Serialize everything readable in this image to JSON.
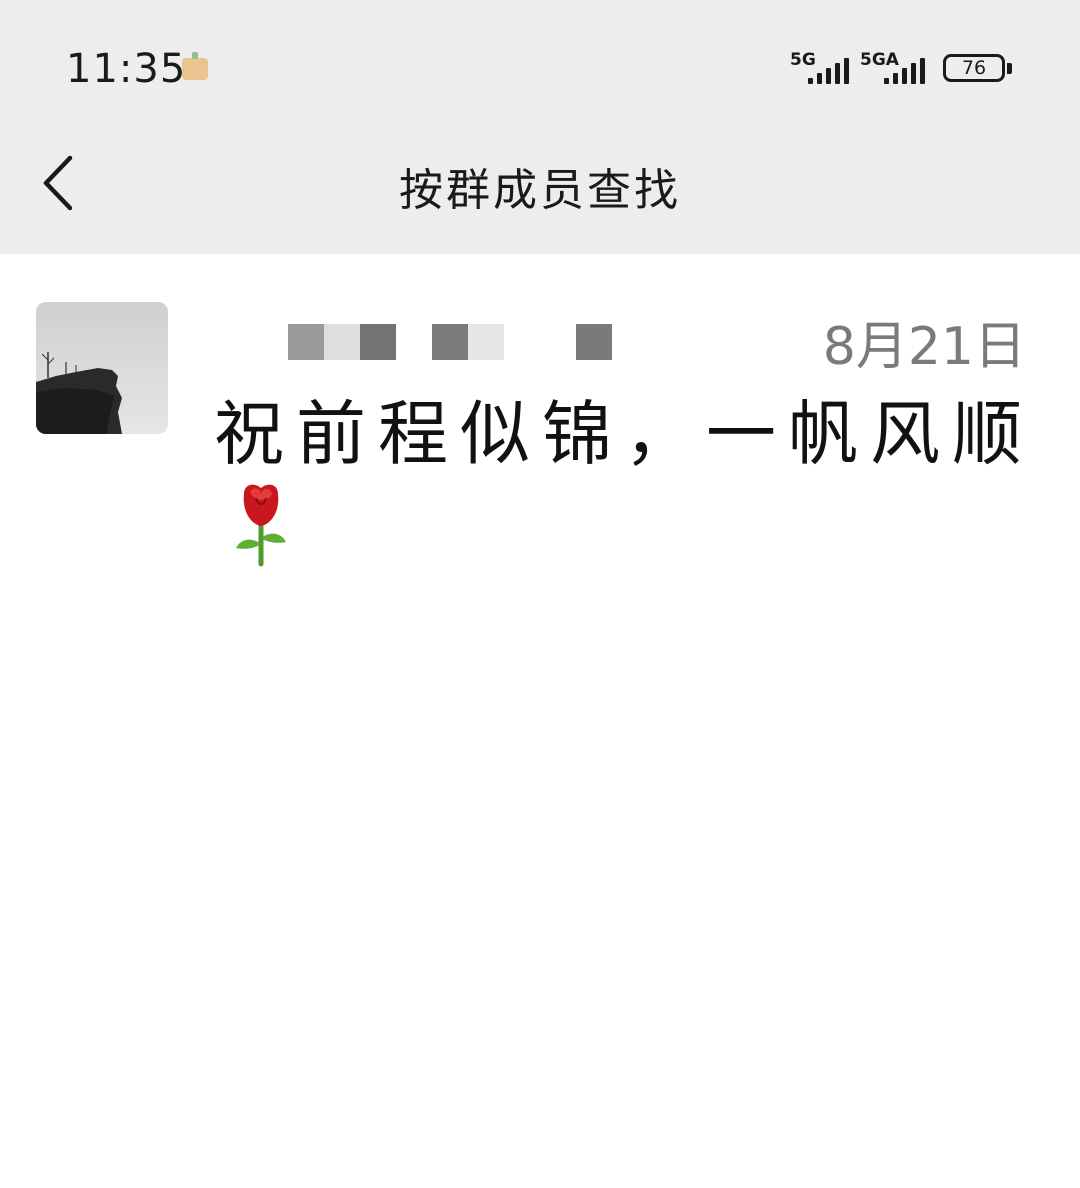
{
  "status_bar": {
    "time": "11:35",
    "notification_icon": "app-notification-icon",
    "signal_1_label": "5G",
    "signal_2_label": "5GA",
    "battery_level": "76"
  },
  "nav": {
    "back_icon": "chevron-left-icon",
    "title": "按群成员查找"
  },
  "results": [
    {
      "avatar": "landscape-cliff-avatar",
      "name": "",
      "date": "8月21日",
      "message": "祝前程似锦，一帆风顺",
      "emoji": "rose-emoji"
    }
  ],
  "colors": {
    "header_bg": "#ededed",
    "content_bg": "#ffffff",
    "date_text": "#7a7a7a",
    "message_text": "#111111"
  }
}
